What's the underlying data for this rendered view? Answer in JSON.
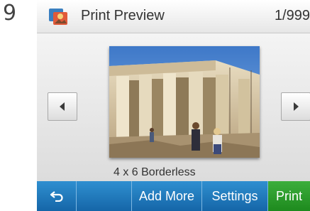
{
  "step_label": "9",
  "header": {
    "title": "Print Preview",
    "page_count": "1/999",
    "app_icon": "photo-app-icon"
  },
  "preview": {
    "size_label": "4 x 6 Borderless",
    "prev_icon": "arrow-left-icon",
    "next_icon": "arrow-right-icon"
  },
  "toolbar": {
    "back_icon": "back-arrow-icon",
    "add_more_label": "Add More",
    "settings_label": "Settings",
    "print_label": "Print"
  },
  "colors": {
    "toolbar_blue": "#1f78bc",
    "print_green": "#2a9a2a"
  }
}
